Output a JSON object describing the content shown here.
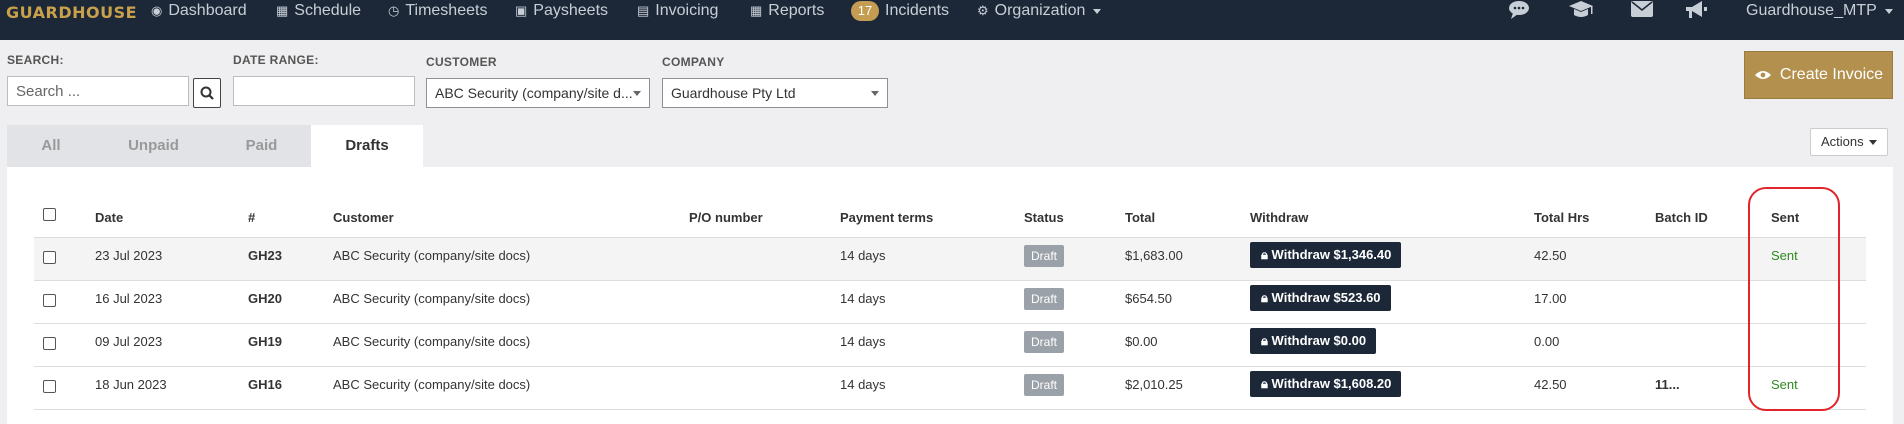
{
  "topnav": {
    "brand": "GUARDHOUSE",
    "items": [
      {
        "label": "Dashboard",
        "icon": "palette-icon"
      },
      {
        "label": "Schedule",
        "icon": "calendar-icon"
      },
      {
        "label": "Timesheets",
        "icon": "clock-icon"
      },
      {
        "label": "Paysheets",
        "icon": "money-icon"
      },
      {
        "label": "Invoicing",
        "icon": "invoice-icon"
      },
      {
        "label": "Reports",
        "icon": "table-icon"
      },
      {
        "label": "Incidents",
        "badge": "17"
      },
      {
        "label": "Organization",
        "icon": "sitemap-icon"
      }
    ],
    "user": "Guardhouse_MTP"
  },
  "filters": {
    "search_label": "SEARCH:",
    "search_placeholder": "Search ...",
    "date_label": "DATE RANGE:",
    "date_value": "",
    "customer_label": "CUSTOMER",
    "customer_value": "ABC Security (company/site d...",
    "company_label": "COMPANY",
    "company_value": "Guardhouse Pty Ltd"
  },
  "create_invoice": "Create Invoice",
  "tabs": [
    "All",
    "Unpaid",
    "Paid",
    "Drafts"
  ],
  "actions_label": "Actions",
  "table": {
    "headers": [
      "Date",
      "#",
      "Customer",
      "P/O number",
      "Payment terms",
      "Status",
      "Total",
      "Withdraw",
      "Total Hrs",
      "Batch ID",
      "Sent"
    ],
    "rows": [
      {
        "date": "23 Jul 2023",
        "num": "GH23",
        "customer": "ABC Security (company/site docs)",
        "po": "",
        "terms": "14 days",
        "status": "Draft",
        "total": "$1,683.00",
        "withdraw": "Withdraw $1,346.40",
        "hrs": "42.50",
        "batch": "",
        "sent": "Sent"
      },
      {
        "date": "16 Jul 2023",
        "num": "GH20",
        "customer": "ABC Security (company/site docs)",
        "po": "",
        "terms": "14 days",
        "status": "Draft",
        "total": "$654.50",
        "withdraw": "Withdraw $523.60",
        "hrs": "17.00",
        "batch": "",
        "sent": ""
      },
      {
        "date": "09 Jul 2023",
        "num": "GH19",
        "customer": "ABC Security (company/site docs)",
        "po": "",
        "terms": "14 days",
        "status": "Draft",
        "total": "$0.00",
        "withdraw": "Withdraw $0.00",
        "hrs": "0.00",
        "batch": "",
        "sent": ""
      },
      {
        "date": "18 Jun 2023",
        "num": "GH16",
        "customer": "ABC Security (company/site docs)",
        "po": "",
        "terms": "14 days",
        "status": "Draft",
        "total": "$2,010.25",
        "withdraw": "Withdraw $1,608.20",
        "hrs": "42.50",
        "batch": "11...",
        "sent": "Sent"
      }
    ]
  },
  "colors": {
    "nav_bg": "#1c2838",
    "brand": "#c9a14a",
    "accent_button": "#b3904e",
    "sent_text": "#2e8b1f",
    "highlight": "#e2252b"
  }
}
